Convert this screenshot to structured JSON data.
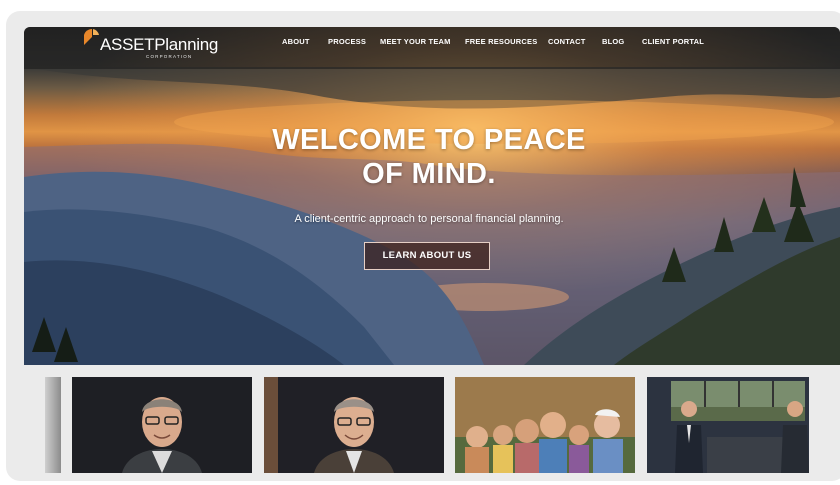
{
  "logo": {
    "name": "ASSETPlanning",
    "subtitle": "CORPORATION",
    "mark_color": "#e8872a"
  },
  "nav": {
    "items": [
      {
        "label": "ABOUT"
      },
      {
        "label": "PROCESS"
      },
      {
        "label": "MEET YOUR TEAM"
      },
      {
        "label": "FREE RESOURCES"
      },
      {
        "label": "CONTACT"
      },
      {
        "label": "BLOG"
      },
      {
        "label": "CLIENT PORTAL"
      }
    ]
  },
  "hero": {
    "title": "WELCOME TO PEACE\nOF MIND.",
    "subtitle": "A client-centric approach to personal financial planning.",
    "cta_label": "LEARN ABOUT US"
  },
  "thumbnails": [
    {
      "subject": "partial-image"
    },
    {
      "subject": "man-with-glasses-interview"
    },
    {
      "subject": "man-with-glasses-interview"
    },
    {
      "subject": "family-group-photo"
    },
    {
      "subject": "tv-studio-news-set"
    }
  ],
  "colors": {
    "accent": "#e8872a",
    "button_bg": "#3c1e19",
    "frame_bg": "#ebebeb"
  }
}
